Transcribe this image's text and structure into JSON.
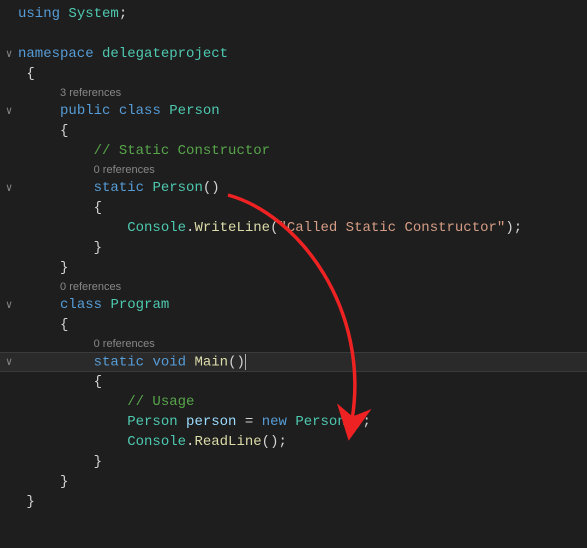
{
  "code": {
    "using_kw": "using",
    "system": "System",
    "namespace_kw": "namespace",
    "namespace_name": "delegateproject",
    "public_kw": "public",
    "class_kw": "class",
    "person_cls": "Person",
    "static_kw": "static",
    "void_kw": "void",
    "main_mth": "Main",
    "new_kw": "new",
    "console_cls": "Console",
    "writeline_mth": "WriteLine",
    "readline_mth": "ReadLine",
    "string_literal": "\"Called Static Constructor\"",
    "program_cls": "Program",
    "person_var": "person",
    "comment_static": "// Static Constructor",
    "comment_usage": "// Usage",
    "ref3": "3 references",
    "ref0a": "0 references",
    "ref0b": "0 references",
    "ref0c": "0 references",
    "brace_open": "{",
    "brace_close": "}",
    "paren_open": "(",
    "paren_close": ")",
    "semicolon": ";",
    "dot": ".",
    "equals": " = "
  },
  "annotation": {
    "arrow_color": "#ee2222"
  }
}
